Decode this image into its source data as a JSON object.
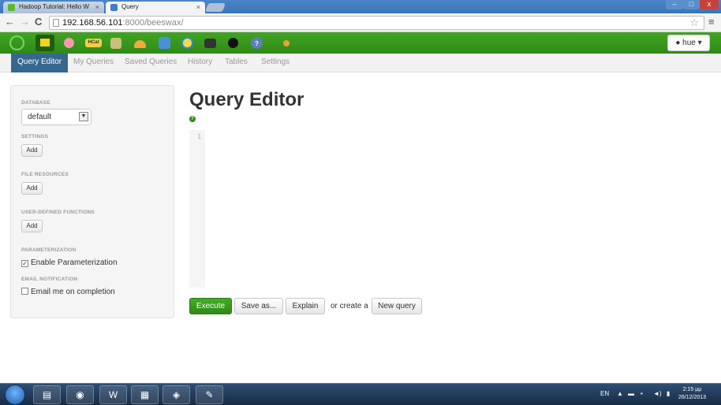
{
  "browser": {
    "tabs": [
      {
        "title": "Hadoop Tutorial: Hello W",
        "close": "×"
      },
      {
        "title": "Query",
        "close": "×"
      }
    ],
    "address": {
      "host": "192.168.56.101",
      "rest": ":8000/beeswax/"
    },
    "window_controls": {
      "minimize": "–",
      "maximize": "□",
      "close": "x"
    }
  },
  "hue": {
    "user_menu_label": "hue",
    "app_icons": [
      "hue-home-icon",
      "file-browser-icon",
      "pig-icon",
      "hcat-icon",
      "job-designer-icon",
      "oozie-icon",
      "shell-icon",
      "beeswax-icon",
      "terminal-icon",
      "user-admin-icon",
      "help-icon",
      "settings-icon"
    ],
    "app_icon_texts": {
      "hcat": "HCat"
    }
  },
  "subnav": {
    "items": [
      "Query Editor",
      "My Queries",
      "Saved Queries",
      "History",
      "Tables",
      "Settings"
    ],
    "active": "Query Editor"
  },
  "sidebar": {
    "database_label": "DATABASE",
    "database_value": "default",
    "settings_label": "SETTINGS",
    "file_resources_label": "FILE RESOURCES",
    "udf_label": "USER-DEFINED FUNCTIONS",
    "add_label": "Add",
    "parameterization_label": "PARAMETERIZATION",
    "parameterization_check": {
      "label": "Enable Parameterization",
      "checked": true
    },
    "email_label": "EMAIL NOTIFICATION",
    "email_check": {
      "label": "Email me on completion",
      "checked": false
    }
  },
  "main": {
    "title": "Query Editor",
    "help_glyph": "?",
    "line_number": "1",
    "buttons": {
      "execute": "Execute",
      "save_as": "Save as...",
      "explain": "Explain",
      "or_create": "or create a",
      "new_query": "New query"
    }
  },
  "taskbar": {
    "apps": [
      "explorer-icon",
      "chrome-icon",
      "word-icon",
      "network-monitor-icon",
      "virtualbox-icon",
      "paint-icon"
    ],
    "lang": "EN",
    "time": "2:15 μμ",
    "date": "26/12/2013"
  },
  "colors": {
    "hue_green": "#338c1a",
    "active_subtab": "#36678f",
    "execute_green": "#45ac29"
  }
}
